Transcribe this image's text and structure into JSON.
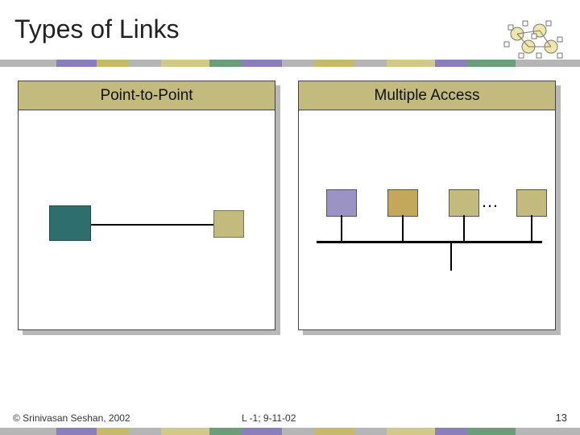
{
  "title": "Types of Links",
  "panels": {
    "left_header": "Point-to-Point",
    "right_header": "Multiple Access",
    "ellipsis": "…"
  },
  "footer": {
    "copyright": "© Srinivasan Seshan, 2002",
    "lecture": "L -1; 9-11-02",
    "page": "13"
  },
  "colors": {
    "header_fill": "#c3bb7d",
    "teal": "#2e6e6c",
    "olive": "#c3bb7d",
    "lavender": "#9a93c4",
    "ochre": "#c3a85c"
  },
  "divider_widths": [
    70,
    50,
    40,
    40,
    60,
    40,
    50,
    40,
    50,
    40,
    60,
    40,
    60,
    40
  ]
}
